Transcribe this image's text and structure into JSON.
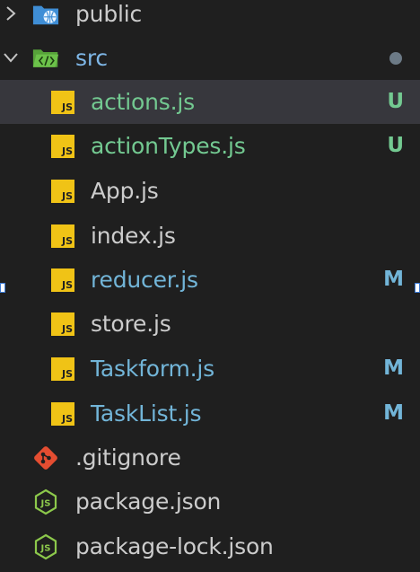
{
  "explorer": {
    "folders": {
      "public": {
        "label": "public",
        "expanded": false,
        "icon": "folder-public-icon"
      },
      "src": {
        "label": "src",
        "expanded": true,
        "icon": "folder-src-icon",
        "has_changes_indicator": true
      }
    },
    "src_files": [
      {
        "name": "actions.js",
        "status": "U",
        "state": "untracked",
        "selected": true
      },
      {
        "name": "actionTypes.js",
        "status": "U",
        "state": "untracked"
      },
      {
        "name": "App.js",
        "status": "",
        "state": "normal"
      },
      {
        "name": "index.js",
        "status": "",
        "state": "normal"
      },
      {
        "name": "reducer.js",
        "status": "M",
        "state": "modified"
      },
      {
        "name": "store.js",
        "status": "",
        "state": "normal"
      },
      {
        "name": "Taskform.js",
        "status": "M",
        "state": "modified"
      },
      {
        "name": "TaskList.js",
        "status": "M",
        "state": "modified"
      }
    ],
    "root_files": [
      {
        "name": ".gitignore",
        "icon": "git-icon"
      },
      {
        "name": "package.json",
        "icon": "nodejs-icon"
      },
      {
        "name": "package-lock.json",
        "icon": "nodejs-icon"
      }
    ],
    "js_badge_text": "JS",
    "colors": {
      "background": "#1f1f1f",
      "selected_row": "#37373d",
      "untracked": "#73c991",
      "modified": "#72b5d8",
      "normal": "#cccccc",
      "js_badge": "#f0c316",
      "git": "#e44d31",
      "nodejs": "#8cc84b"
    }
  }
}
